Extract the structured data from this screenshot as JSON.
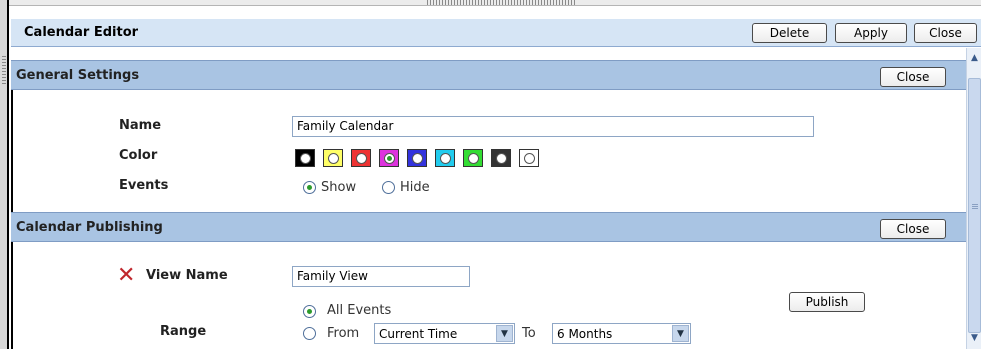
{
  "editor": {
    "title": "Calendar Editor",
    "delete_label": "Delete",
    "apply_label": "Apply",
    "close_label": "Close"
  },
  "general": {
    "title": "General Settings",
    "close_label": "Close",
    "name_label": "Name",
    "name_value": "Family Calendar",
    "color_label": "Color",
    "colors": [
      "#000000",
      "#ffff66",
      "#ee3333",
      "#dd33dd",
      "#3333dd",
      "#22ccee",
      "#33dd33",
      "#333333",
      "#ffffff"
    ],
    "selected_color_index": 3,
    "events_label": "Events",
    "events_show": "Show",
    "events_hide": "Hide",
    "events_selected": "Show"
  },
  "publishing": {
    "title": "Calendar Publishing",
    "close_label": "Close",
    "view_name_label": "View Name",
    "view_name_value": "Family View",
    "publish_label": "Publish",
    "range_label": "Range",
    "all_events_label": "All Events",
    "from_label": "From",
    "from_value": "Current Time",
    "to_label": "To",
    "to_value": "6 Months",
    "range_selected": "All Events"
  },
  "icons": {
    "remove": "x-icon",
    "dropdown": "chevron-down-icon",
    "scroll_up": "chevron-up-icon",
    "scroll_down": "chevron-down-icon"
  }
}
